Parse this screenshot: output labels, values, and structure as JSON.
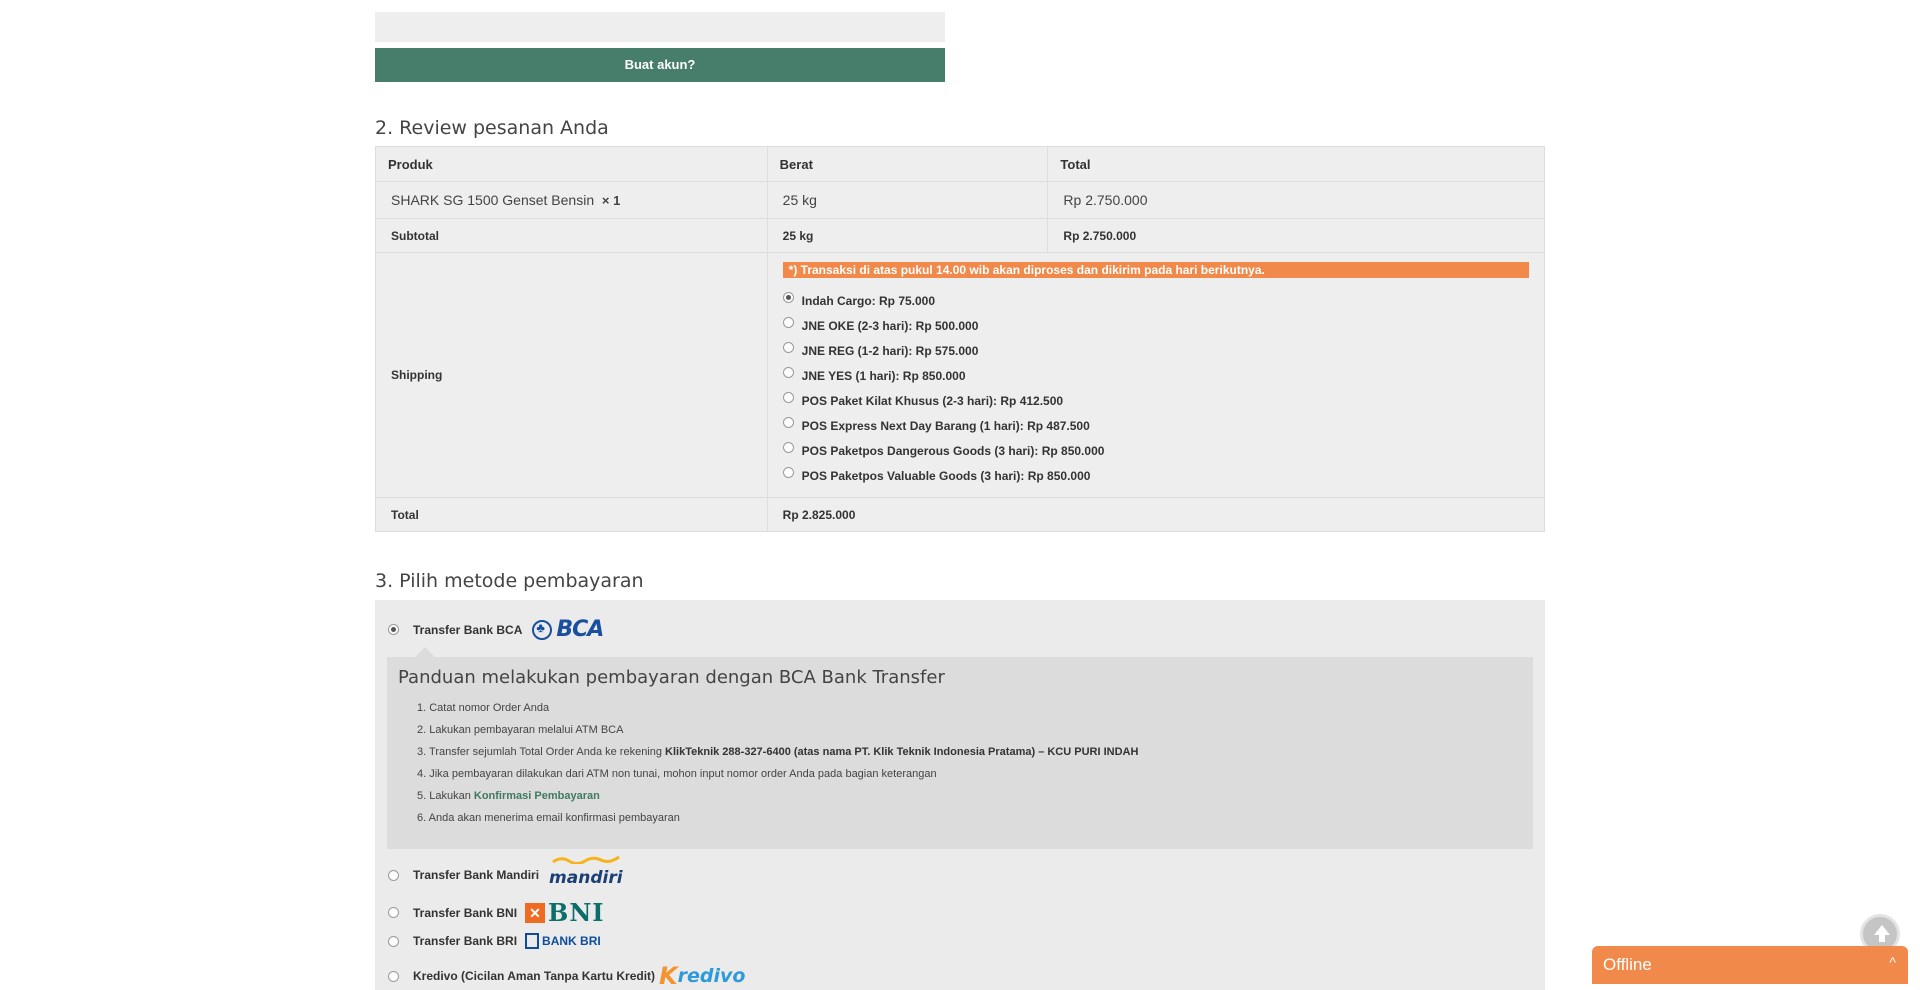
{
  "account": {
    "create_button": "Buat akun?"
  },
  "review": {
    "heading": "2. Review pesanan Anda",
    "columns": [
      "Produk",
      "Berat",
      "Total"
    ],
    "product": {
      "name": "SHARK SG 1500 Genset Bensin",
      "qty": "× 1",
      "weight": "25 kg",
      "total": "Rp 2.750.000"
    },
    "subtotal": {
      "label": "Subtotal",
      "weight": "25 kg",
      "total": "Rp 2.750.000"
    },
    "shipping": {
      "label": "Shipping",
      "notice": "*) Transaksi di atas pukul 14.00 wib akan diproses dan dikirim pada hari berikutnya.",
      "options": [
        {
          "label": "Indah Cargo: Rp 75.000",
          "selected": true
        },
        {
          "label": "JNE OKE (2-3 hari): Rp 500.000",
          "selected": false
        },
        {
          "label": "JNE REG (1-2 hari): Rp 575.000",
          "selected": false
        },
        {
          "label": "JNE YES (1 hari): Rp 850.000",
          "selected": false
        },
        {
          "label": "POS Paket Kilat Khusus (2-3 hari): Rp 412.500",
          "selected": false
        },
        {
          "label": "POS Express Next Day Barang (1 hari): Rp 487.500",
          "selected": false
        },
        {
          "label": "POS Paketpos Dangerous Goods (3 hari): Rp 850.000",
          "selected": false
        },
        {
          "label": "POS Paketpos Valuable Goods (3 hari): Rp 850.000",
          "selected": false
        }
      ]
    },
    "total": {
      "label": "Total",
      "value": "Rp 2.825.000"
    }
  },
  "payment": {
    "heading": "3. Pilih metode pembayaran",
    "methods": [
      {
        "label": "Transfer Bank BCA",
        "logo": "BCA",
        "selected": true
      },
      {
        "label": "Transfer Bank Mandiri",
        "logo": "mandiri",
        "selected": false
      },
      {
        "label": "Transfer Bank BNI",
        "logo": "BNI",
        "selected": false
      },
      {
        "label": "Transfer Bank BRI",
        "logo": "BANK BRI",
        "selected": false
      },
      {
        "label": "Kredivo (Cicilan Aman Tanpa Kartu Kredit)",
        "logo": "redivo",
        "logo_prefix": "K",
        "selected": false
      }
    ],
    "guide": {
      "title": "Panduan melakukan pembayaran dengan BCA Bank Transfer",
      "steps": [
        "1. Catat nomor Order Anda",
        "2. Lakukan pembayaran melalui ATM BCA",
        "3. Transfer sejumlah Total Order Anda ke rekening ",
        "4. Jika pembayaran dilakukan dari ATM non tunai, mohon input nomor order Anda pada bagian keterangan",
        "5. Lakukan ",
        "6. Anda akan menerima email konfirmasi pembayaran"
      ],
      "step3_bold": "KlikTeknik 288-327-6400 (atas nama PT. Klik Teknik Indonesia Pratama) – KCU PURI INDAH",
      "step5_link": "Konfirmasi Pembayaran"
    }
  },
  "chat": {
    "status": "Offline",
    "chevron": "^"
  },
  "icons": {
    "scroll_top": "arrow-up-icon",
    "chat_toggle": "chevron-up-icon"
  },
  "colors": {
    "green": "#477d6b",
    "orange": "#f0894a",
    "panel": "#eeeeee"
  }
}
